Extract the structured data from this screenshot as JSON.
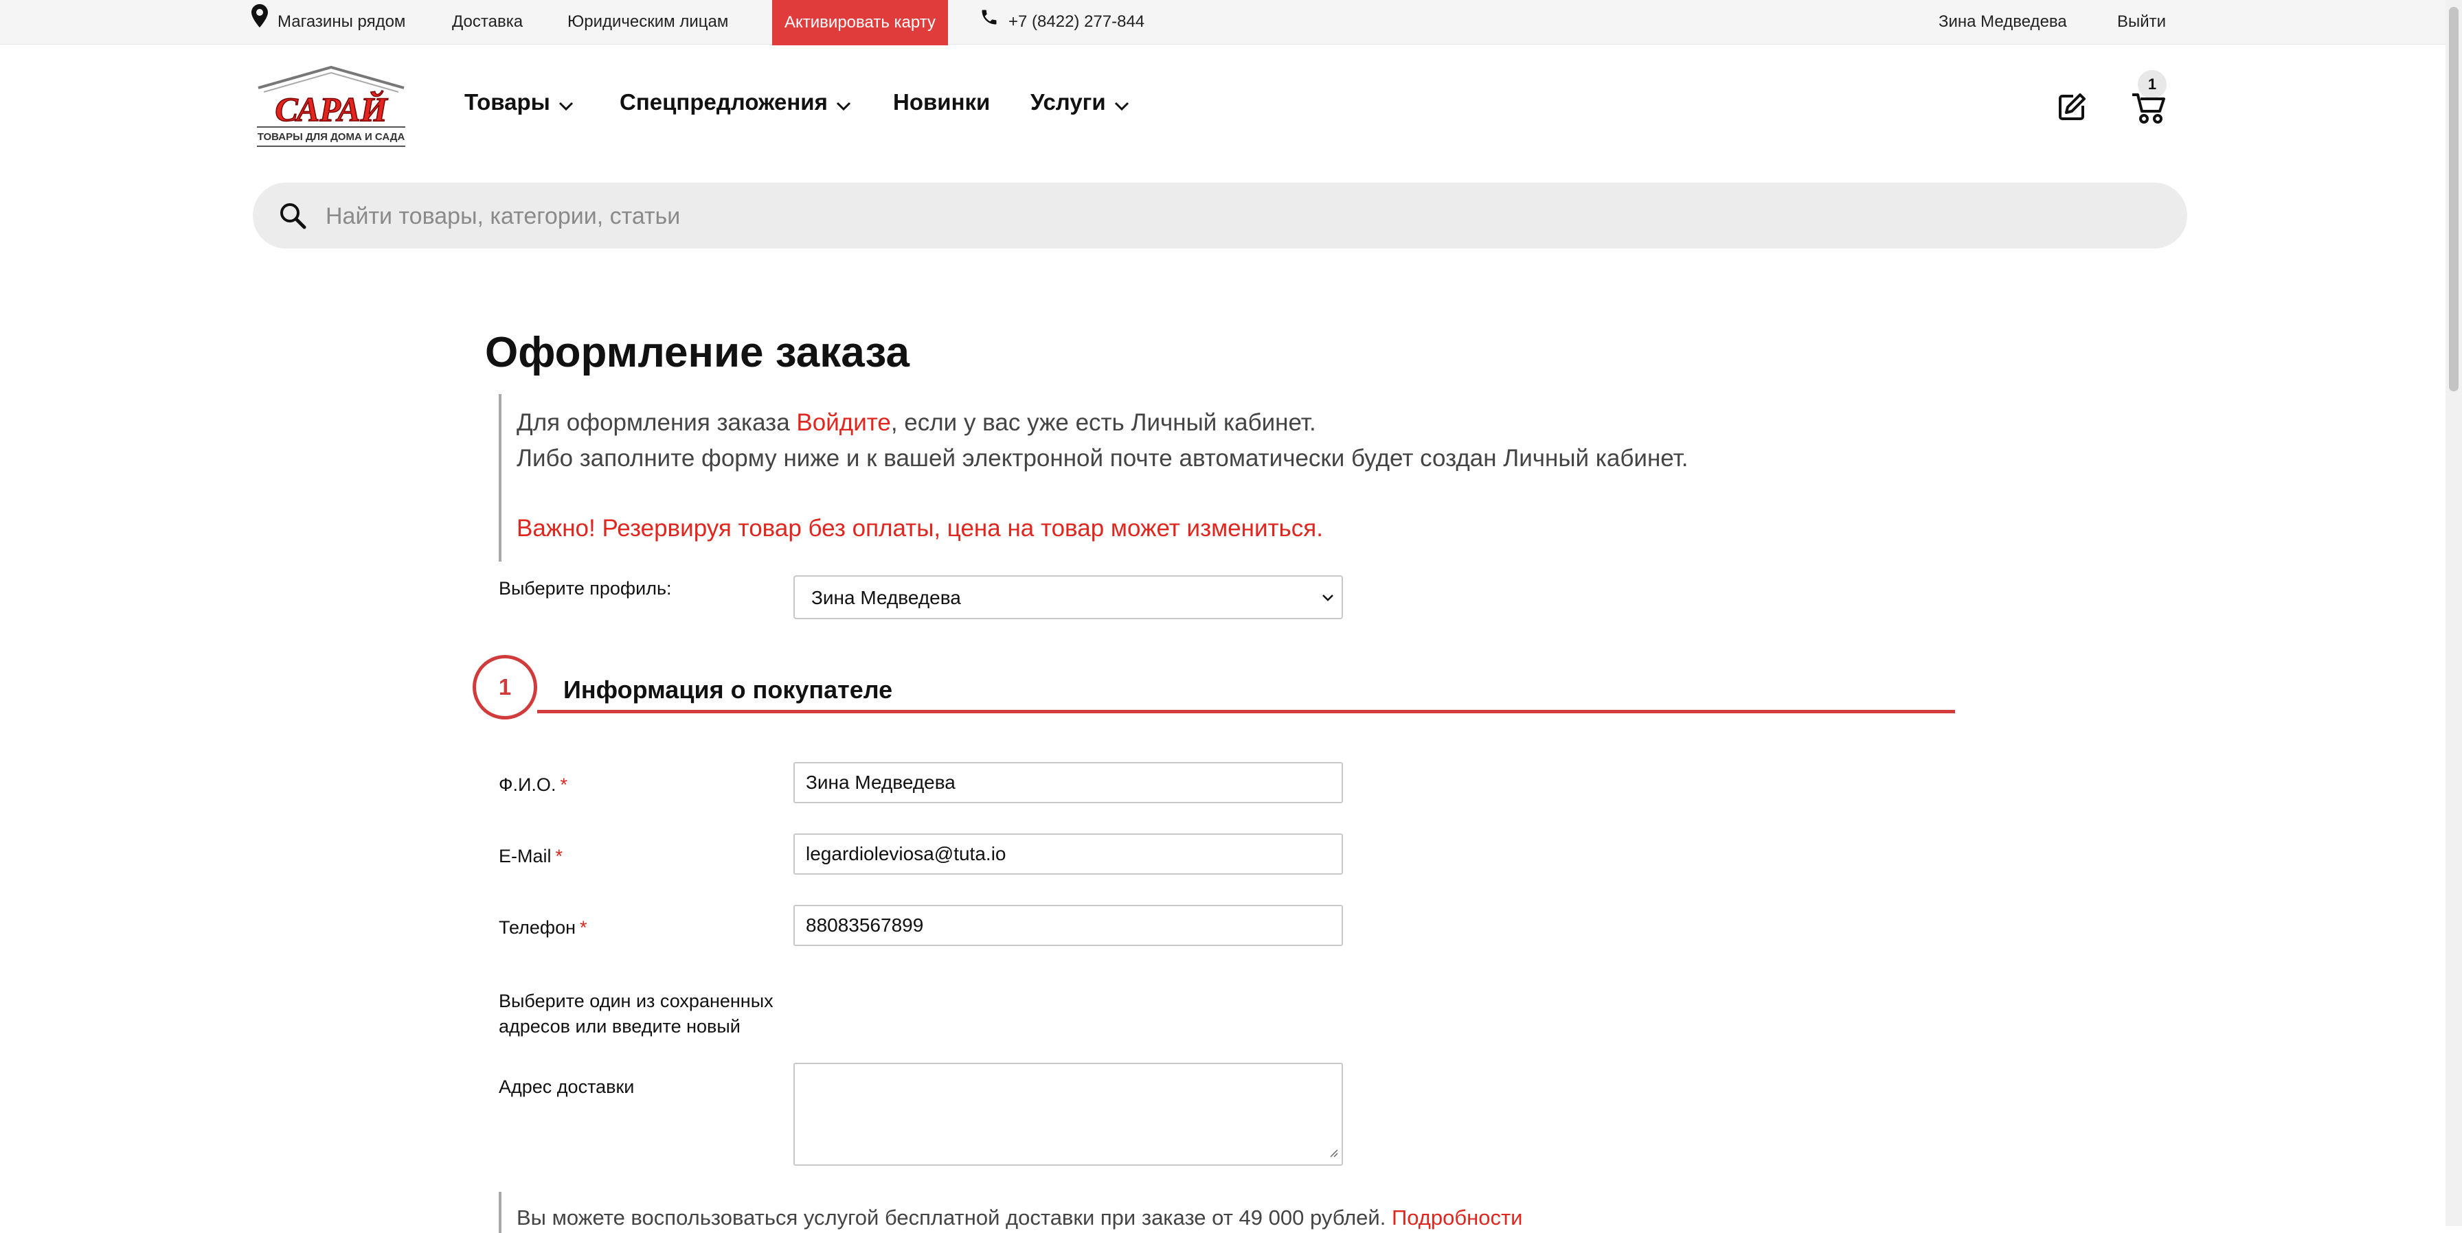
{
  "topbar": {
    "stores_label": "Магазины рядом",
    "delivery_label": "Доставка",
    "legal_label": "Юридическим лицам",
    "activate_card_label": "Активировать карту",
    "phone": "+7 (8422) 277-844",
    "user_name": "Зина Медведева",
    "logout_label": "Выйти"
  },
  "logo": {
    "name": "САРАЙ",
    "tagline": "ТОВАРЫ ДЛЯ ДОМА И САДА"
  },
  "nav": {
    "items": [
      {
        "label": "Товары",
        "has_dropdown": true
      },
      {
        "label": "Спецпредложения",
        "has_dropdown": true
      },
      {
        "label": "Новинки",
        "has_dropdown": false
      },
      {
        "label": "Услуги",
        "has_dropdown": true
      }
    ]
  },
  "cart": {
    "count": "1"
  },
  "search": {
    "placeholder": "Найти товары, категории, статьи"
  },
  "page": {
    "title": "Оформление заказа"
  },
  "notice": {
    "line1_pre": "Для оформления заказа ",
    "line1_link": "Войдите",
    "line1_post": ", если у вас уже есть Личный кабинет.",
    "line2": "Либо заполните форму ниже и к вашей электронной почте автоматически будет создан Личный кабинет.",
    "warning": "Важно! Резервируя товар без оплаты, цена на товар может измениться."
  },
  "profile": {
    "label": "Выберите профиль:",
    "selected": "Зина Медведева"
  },
  "step1": {
    "number": "1",
    "title": "Информация о покупателе"
  },
  "form": {
    "fio_label": "Ф.И.О.",
    "fio_value": "Зина Медведева",
    "email_label": "E-Mail",
    "email_value": "legardioleviosa@tuta.io",
    "phone_label": "Телефон",
    "phone_value": "88083567899",
    "required_mark": "*",
    "saved_address_line1": "Выберите один из сохраненных",
    "saved_address_line2": "адресов или введите новый",
    "address_label": "Адрес доставки",
    "address_value": ""
  },
  "delivery_note": {
    "text": "Вы можете воспользоваться услугой бесплатной доставки при заказе от 49 000 рублей.",
    "link": "Подробности"
  },
  "colors": {
    "accent": "#e03c3c",
    "link_red": "#e0261e",
    "step_red": "#d23b3b"
  }
}
